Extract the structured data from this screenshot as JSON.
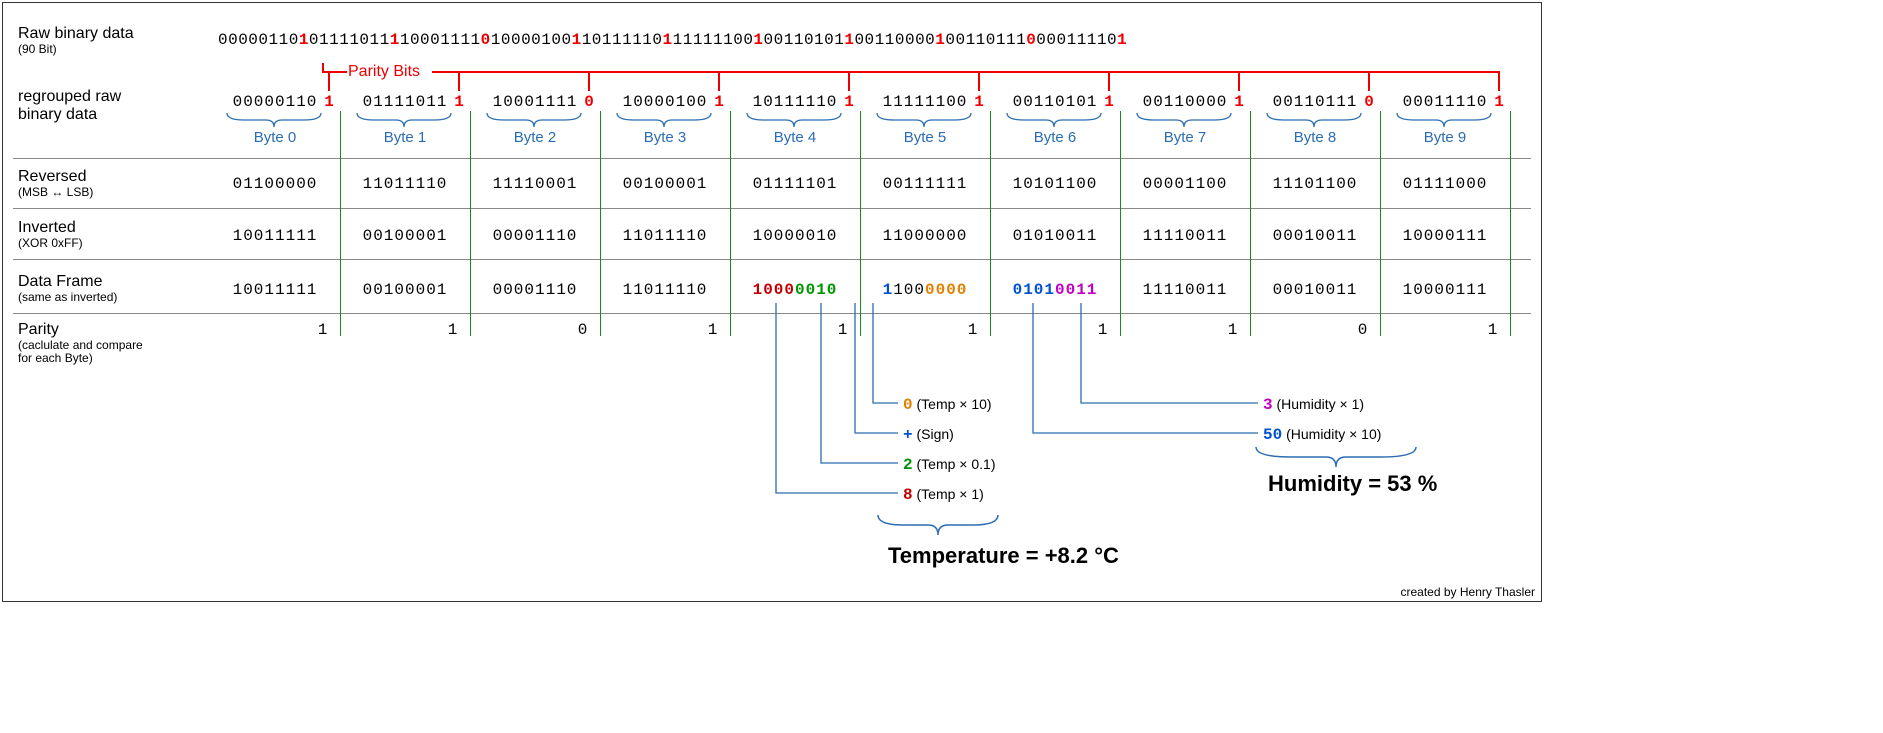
{
  "labels": {
    "raw_title": "Raw binary data",
    "raw_sub": "(90 Bit)",
    "regrouped_title": "regrouped raw",
    "regrouped_sub": "binary data",
    "parity_bits": "Parity Bits",
    "reversed_title": "Reversed",
    "reversed_sub": "(MSB ↔ LSB)",
    "inverted_title": "Inverted",
    "inverted_sub": "(XOR 0xFF)",
    "dataframe_title": "Data Frame",
    "dataframe_sub": "(same as inverted)",
    "parity_title": "Parity",
    "parity_sub": "(caclulate and compare\nfor each Byte)",
    "credit": "created by Henry Thasler"
  },
  "raw_bits": "000001101011110111100011110100001001101111101111111001001101011001100001001101110000111101",
  "raw_parity_positions": [
    8,
    17,
    26,
    35,
    44,
    53,
    62,
    71,
    80,
    89
  ],
  "bytes": {
    "regrouped": [
      "00000110",
      "01111011",
      "10001111",
      "10000100",
      "10111110",
      "11111100",
      "00110101",
      "00110000",
      "00110111",
      "00011110"
    ],
    "parity": [
      "1",
      "1",
      "0",
      "1",
      "1",
      "1",
      "1",
      "1",
      "0",
      "1"
    ],
    "reversed": [
      "01100000",
      "11011110",
      "11110001",
      "00100001",
      "01111101",
      "00111111",
      "10101100",
      "00001100",
      "11101100",
      "01111000"
    ],
    "inverted": [
      "10011111",
      "00100001",
      "00001110",
      "11011110",
      "10000010",
      "11000000",
      "01010011",
      "11110011",
      "00010011",
      "10000111"
    ],
    "dataframe": [
      "10011111",
      "00100001",
      "00001110",
      "11011110",
      "10000010",
      "11000000",
      "01010011",
      "11110011",
      "00010011",
      "10000111"
    ],
    "parity_calc": [
      "1",
      "1",
      "0",
      "1",
      "1",
      "1",
      "1",
      "1",
      "0",
      "1"
    ]
  },
  "byte_labels": [
    "Byte 0",
    "Byte 1",
    "Byte 2",
    "Byte 3",
    "Byte 4",
    "Byte 5",
    "Byte 6",
    "Byte 7",
    "Byte 8",
    "Byte 9"
  ],
  "decoded": {
    "temp_x10": {
      "val": "0",
      "note": "(Temp × 10)"
    },
    "sign": {
      "val": "+",
      "note": "(Sign)"
    },
    "temp_x01": {
      "val": "2",
      "note": "(Temp × 0.1)"
    },
    "temp_x1": {
      "val": "8",
      "note": "(Temp × 1)"
    },
    "hum_x1": {
      "val": "3",
      "note": "(Humidity × 1)"
    },
    "hum_x10": {
      "val": "50",
      "note": "(Humidity × 10)"
    }
  },
  "results": {
    "temperature": "Temperature = +8.2 °C",
    "humidity": "Humidity = 53 %"
  }
}
